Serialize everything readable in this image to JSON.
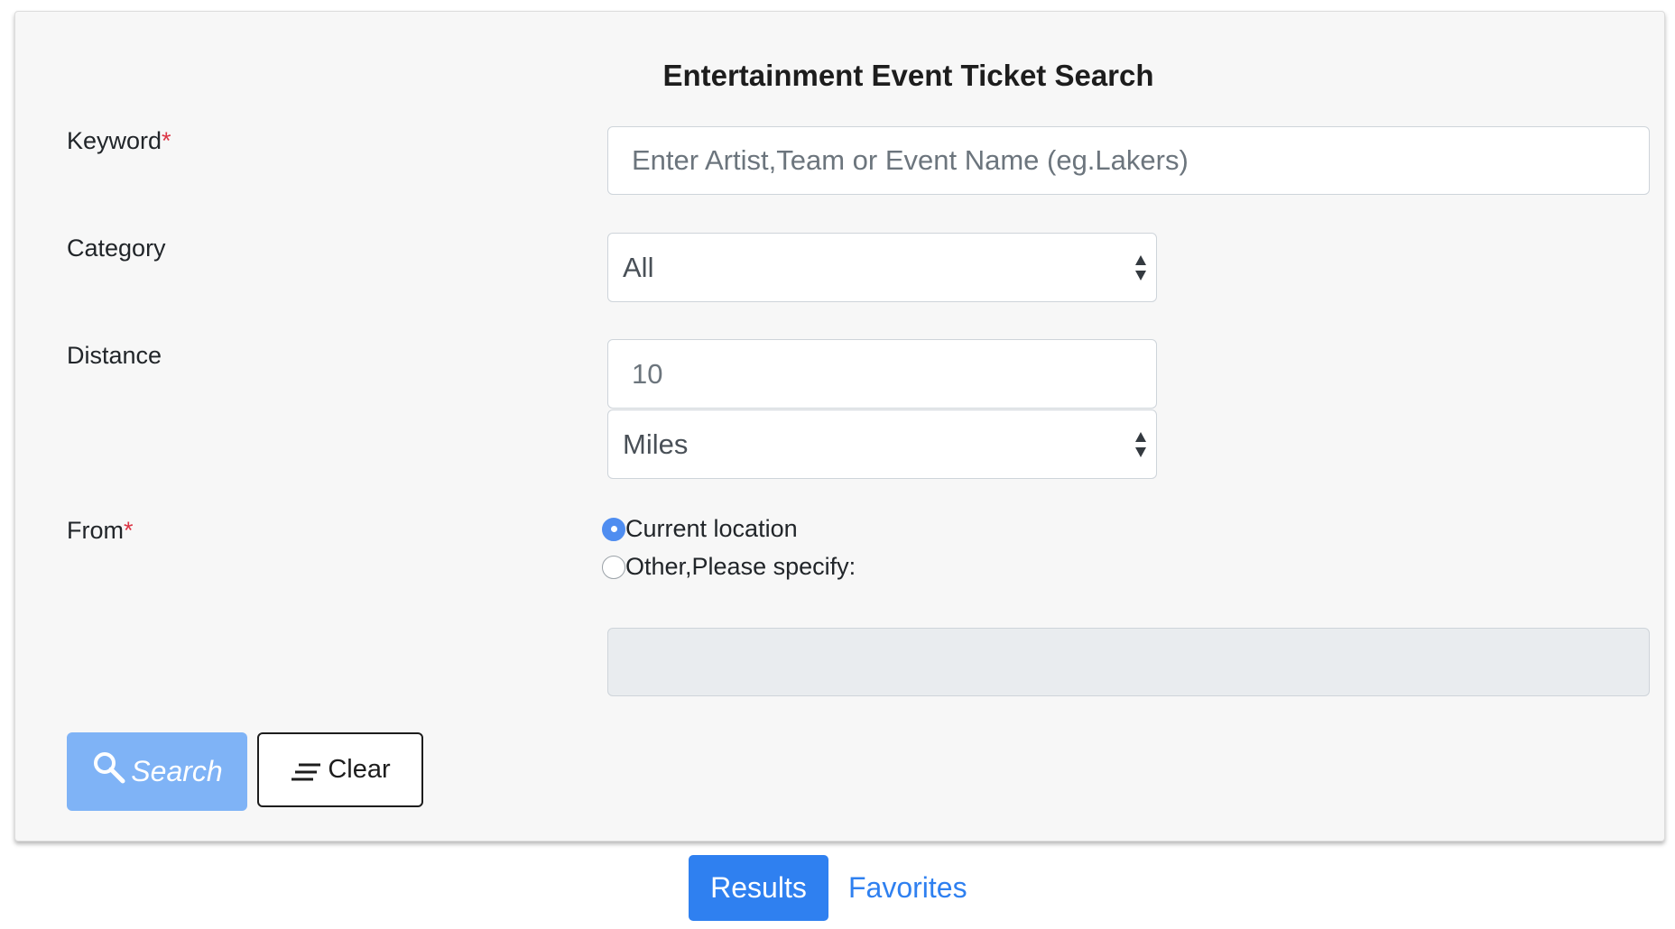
{
  "form": {
    "title": "Entertainment Event Ticket Search",
    "keyword": {
      "label": "Keyword",
      "required_mark": "*",
      "value": "",
      "placeholder": "Enter Artist,Team or Event Name (eg.Lakers)"
    },
    "category": {
      "label": "Category",
      "selected": "All"
    },
    "distance": {
      "label": "Distance",
      "value": "10",
      "unit_selected": "Miles"
    },
    "from": {
      "label": "From",
      "required_mark": "*",
      "options": [
        {
          "label": "Current location",
          "checked": true
        },
        {
          "label": "Other,Please specify:",
          "checked": false
        }
      ],
      "other_location_value": ""
    },
    "search_label": "Search",
    "clear_label": "Clear"
  },
  "tabs": {
    "results_label": "Results",
    "favorites_label": "Favorites"
  },
  "colors": {
    "primary": "#2f80f0",
    "search_button": "#7fb3f6",
    "required": "#dc3545",
    "panel_bg": "#f7f7f7"
  }
}
